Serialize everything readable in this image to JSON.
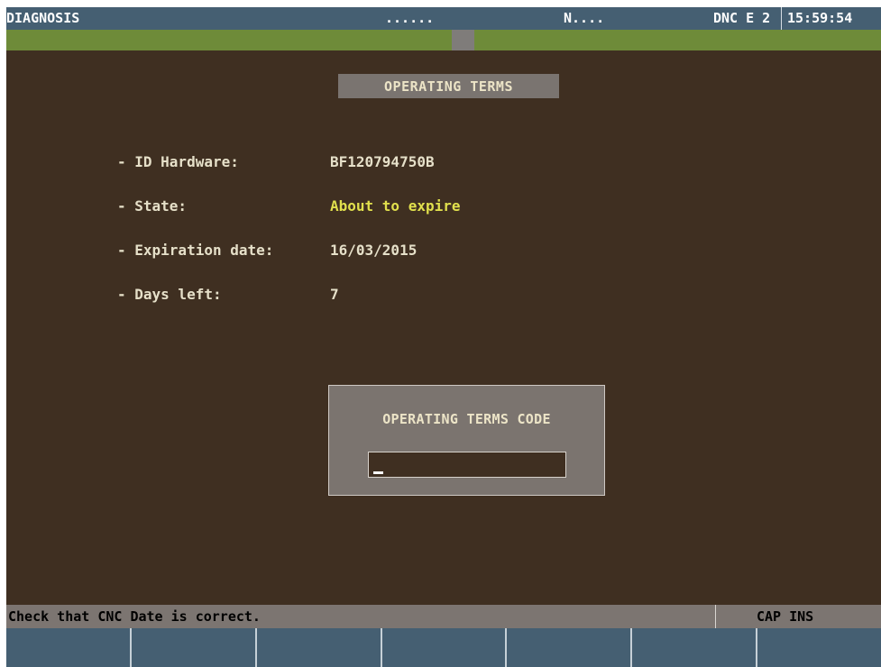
{
  "header": {
    "mode": "DIAGNOSIS",
    "program_dots": "......",
    "block": "N....",
    "dnc": "DNC E 2",
    "time": "15:59:54"
  },
  "panel": {
    "title": "OPERATING TERMS",
    "fields": [
      {
        "label": "- ID Hardware:",
        "value": "BF120794750B"
      },
      {
        "label": "- State:",
        "value": "About to expire",
        "highlight": "#e1e04d"
      },
      {
        "label": "- Expiration date:",
        "value": "16/03/2015"
      },
      {
        "label": "- Days left:",
        "value": "7"
      }
    ]
  },
  "code_dialog": {
    "title": "OPERATING TERMS CODE",
    "value": ""
  },
  "status": {
    "message": "Check that CNC Date is correct.",
    "mode": "CAP INS"
  },
  "softkeys": [
    "",
    "",
    "",
    "",
    "",
    "",
    ""
  ],
  "colors": {
    "header_bg": "#455f72",
    "work_bg": "#3f2f21",
    "green_strip": "#6e8b39",
    "panel_gray": "#7a7470",
    "warning_text": "#e1e04d"
  }
}
